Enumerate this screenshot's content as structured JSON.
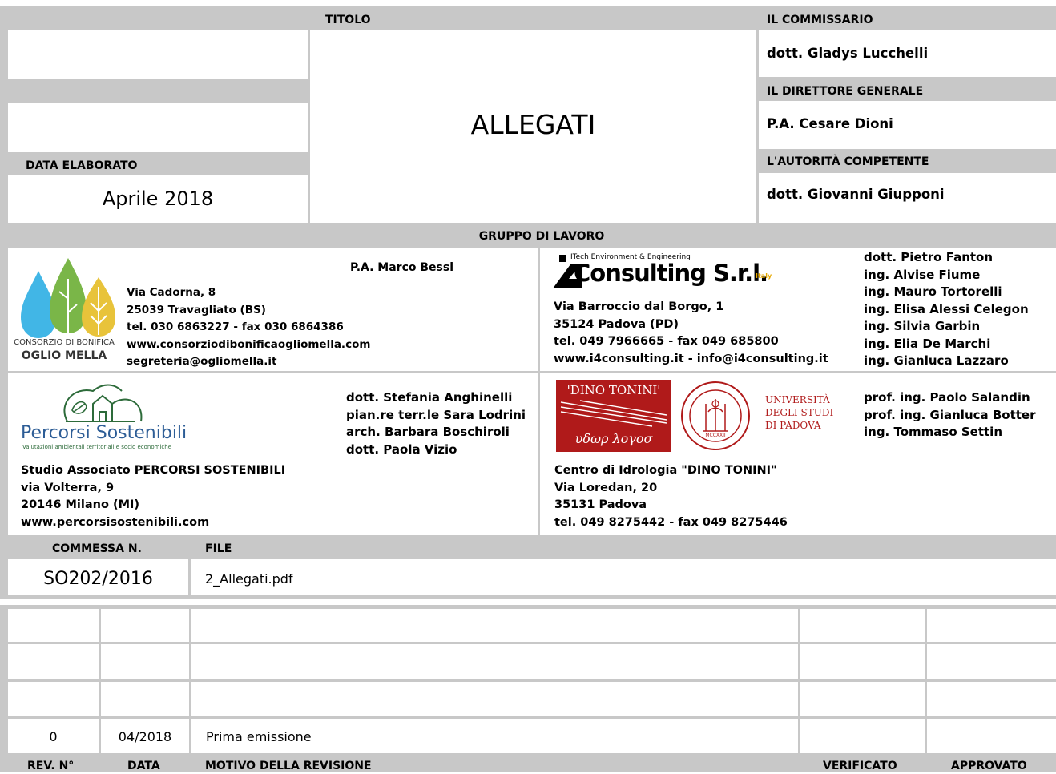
{
  "top": {
    "titolo_label": "TITOLO",
    "title": "ALLEGATI",
    "data_label": "DATA ELABORATO",
    "data_value": "Aprile 2018",
    "commissario_label": "IL COMMISSARIO",
    "commissario_name": "dott. Gladys Lucchelli",
    "direttore_label": "IL DIRETTORE GENERALE",
    "direttore_name": "P.A. Cesare Dioni",
    "autorita_label": "L'AUTORITÀ COMPETENTE",
    "autorita_name": "dott. Giovanni Giupponi"
  },
  "gruppo": {
    "label": "GRUPPO DI LAVORO",
    "oglio": {
      "logo_line1": "CONSORZIO DI BONIFICA",
      "logo_line2": "OGLIO MELLA",
      "person": "P.A. Marco Bessi",
      "address": "Via Cadorna, 8\n25039 Travagliato (BS)\ntel. 030 6863227 - fax 030 6864386\nwww.consorziodibonificaogliomella.com\nsegreteria@ogliomella.it"
    },
    "i4": {
      "logo_small": "ITech Environment & Engineering",
      "logo_main": "Consulting S.r.l.",
      "logo_italy": "Italy",
      "address": "Via Barroccio dal Borgo, 1\n35124 Padova (PD)\ntel. 049 7966665 - fax 049 685800\nwww.i4consulting.it - info@i4consulting.it",
      "people": "dott. Pietro Fanton\ning. Alvise Fiume\ning. Mauro Tortorelli\ning. Elisa Alessi Celegon\ning. Silvia Garbin\ning. Elia De Marchi\ning. Gianluca Lazzaro"
    },
    "percorsi": {
      "logo_name": "Percorsi Sostenibili",
      "logo_tagline": "Valutazioni ambientali territoriali e socio economiche",
      "people": "dott. Stefania Anghinelli\npian.re terr.le Sara Lodrini\narch. Barbara Boschiroli\ndott. Paola Vizio",
      "address": "Studio Associato PERCORSI SOSTENIBILI\nvia Volterra, 9\n20146 Milano (MI)\nwww.percorsisostenibili.com"
    },
    "tonini": {
      "logo_top": "'DINO TONINI'",
      "logo_bottom": "υδωρ λογοσ",
      "uni_line1": "UNIVERSITÀ",
      "uni_line2": "DEGLI STUDI",
      "uni_line3": "DI PADOVA",
      "seal_year": "MCCXXII",
      "people": "prof. ing. Paolo Salandin\nprof. ing. Gianluca Botter\ning. Tommaso Settin",
      "address": "Centro di Idrologia \"DINO TONINI\"\nVia Loredan, 20\n35131 Padova\ntel. 049 8275442 - fax 049 8275446"
    }
  },
  "commessa": {
    "commessa_label": "COMMESSA N.",
    "file_label": "FILE",
    "commessa_value": "SO202/2016",
    "file_value": "2_Allegati.pdf"
  },
  "revisions": {
    "headers": {
      "rev": "REV. N°",
      "data": "DATA",
      "motivo": "MOTIVO DELLA REVISIONE",
      "verificato": "VERIFICATO",
      "approvato": "APPROVATO"
    },
    "row": {
      "rev": "0",
      "data": "04/2018",
      "motivo": "Prima emissione",
      "verificato": "",
      "approvato": ""
    }
  }
}
